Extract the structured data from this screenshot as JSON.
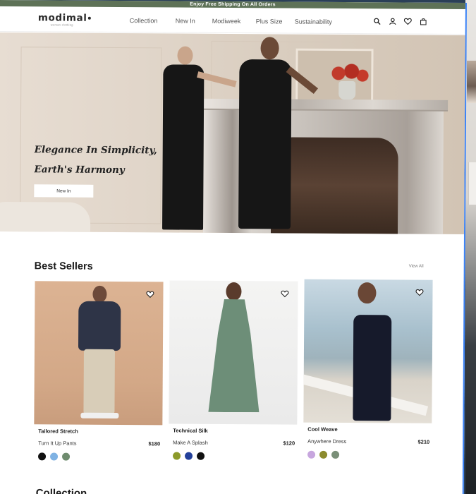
{
  "promo": {
    "text": "Enjoy Free Shipping On All Orders"
  },
  "brand": {
    "name": "modimal",
    "tagline": "woman clothing"
  },
  "nav": {
    "items": [
      "Collection",
      "New In",
      "Modiweek",
      "Plus Size",
      "Sustainability"
    ]
  },
  "header_icons": [
    "search-icon",
    "user-icon",
    "heart-icon",
    "bag-icon"
  ],
  "hero": {
    "title_line1": "Elegance In Simplicity,",
    "title_line2": "Earth's Harmony",
    "cta": "New In"
  },
  "best_sellers": {
    "title": "Best Sellers",
    "view_all": "View All",
    "products": [
      {
        "name": "Tailored Stretch",
        "subtitle": "Turn It Up Pants",
        "price": "$180",
        "swatches": [
          "#111111",
          "#7fb2e3",
          "#6f8c6f"
        ]
      },
      {
        "name": "Technical Silk",
        "subtitle": "Make A Splash",
        "price": "$120",
        "swatches": [
          "#8c9a2a",
          "#23409a",
          "#111111"
        ]
      },
      {
        "name": "Cool Weave",
        "subtitle": "Anywhere Dress",
        "price": "$210",
        "swatches": [
          "#c7a6de",
          "#8c8b2e",
          "#7a8f78"
        ]
      }
    ]
  },
  "next_section": {
    "title": "Collection"
  },
  "colors": {
    "promo_bar": "#5e7257",
    "text": "#1c1c1c",
    "accent_border": "#3b82f6"
  }
}
